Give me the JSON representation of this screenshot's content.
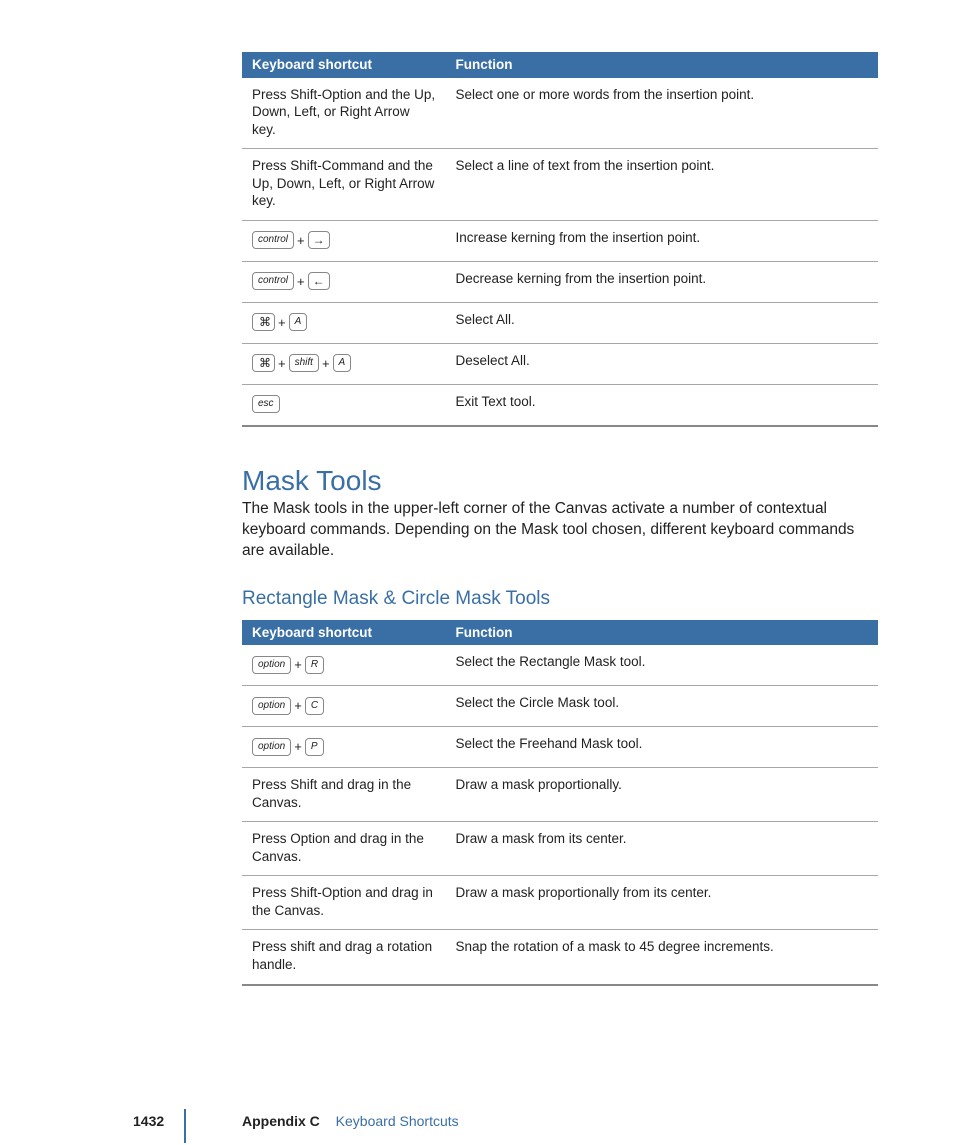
{
  "table1": {
    "headers": {
      "shortcut": "Keyboard shortcut",
      "func": "Function"
    },
    "rows": [
      {
        "shortcut_text": "Press Shift-Option and the Up, Down, Left, or Right Arrow key.",
        "func": "Select one or more words from the insertion point."
      },
      {
        "shortcut_text": "Press Shift-Command and the Up, Down, Left, or Right Arrow key.",
        "func": "Select a line of text from the insertion point."
      },
      {
        "keys": [
          "control",
          "→"
        ],
        "key_types": [
          "text",
          "arrow"
        ],
        "func": "Increase kerning from the insertion point."
      },
      {
        "keys": [
          "control",
          "←"
        ],
        "key_types": [
          "text",
          "arrow"
        ],
        "func": "Decrease kerning from the insertion point."
      },
      {
        "keys": [
          "⌘",
          "A"
        ],
        "key_types": [
          "cmd",
          "text"
        ],
        "func": "Select All."
      },
      {
        "keys": [
          "⌘",
          "shift",
          "A"
        ],
        "key_types": [
          "cmd",
          "text",
          "text"
        ],
        "func": "Deselect All."
      },
      {
        "keys": [
          "esc"
        ],
        "key_types": [
          "text"
        ],
        "func": "Exit Text tool."
      }
    ]
  },
  "section": {
    "title": "Mask Tools",
    "para": "The Mask tools in the upper-left corner of the Canvas activate a number of contextual keyboard commands. Depending on the Mask tool chosen, different keyboard commands are available."
  },
  "subsection": {
    "title": "Rectangle Mask & Circle Mask Tools"
  },
  "table2": {
    "headers": {
      "shortcut": "Keyboard shortcut",
      "func": "Function"
    },
    "rows": [
      {
        "keys": [
          "option",
          "R"
        ],
        "key_types": [
          "text",
          "text"
        ],
        "func": "Select the Rectangle Mask tool."
      },
      {
        "keys": [
          "option",
          "C"
        ],
        "key_types": [
          "text",
          "text"
        ],
        "func": "Select the Circle Mask tool."
      },
      {
        "keys": [
          "option",
          "P"
        ],
        "key_types": [
          "text",
          "text"
        ],
        "func": "Select the Freehand Mask tool."
      },
      {
        "shortcut_text": "Press Shift and drag in the Canvas.",
        "func": "Draw a mask proportionally."
      },
      {
        "shortcut_text": "Press Option and drag in the Canvas.",
        "func": "Draw a mask from its center."
      },
      {
        "shortcut_text": "Press Shift-Option and drag in the Canvas.",
        "func": "Draw a mask proportionally from its center."
      },
      {
        "shortcut_text": "Press shift and drag a rotation handle.",
        "func": "Snap the rotation of a mask to 45 degree increments."
      }
    ]
  },
  "footer": {
    "page": "1432",
    "appendix": "Appendix C",
    "chapter": "Keyboard Shortcuts"
  },
  "glyphs": {
    "apple": "",
    "cmd": "⌘",
    "arrow_right": "→",
    "arrow_left": "←"
  }
}
